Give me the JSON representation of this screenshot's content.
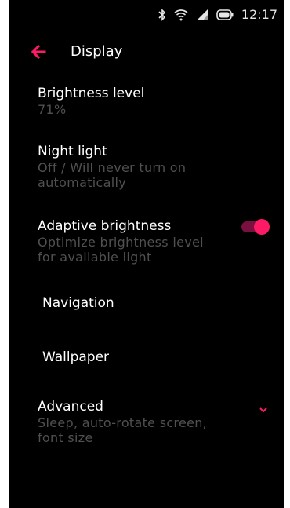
{
  "status_bar": {
    "time": "12:17",
    "icons": [
      "bluetooth-icon",
      "wifi-icon",
      "cell-signal-icon",
      "battery-icon"
    ]
  },
  "app_bar": {
    "back_icon": "arrow-left-icon",
    "title": "Display"
  },
  "settings": {
    "brightness": {
      "title": "Brightness level",
      "value": "71%"
    },
    "night_light": {
      "title": "Night light",
      "summary": "Off / Will never turn on automatically"
    },
    "adaptive_brightness": {
      "title": "Adaptive brightness",
      "summary": "Optimize brightness level for available light",
      "enabled": true
    },
    "navigation": {
      "title": "Navigation"
    },
    "wallpaper": {
      "title": "Wallpaper"
    },
    "advanced": {
      "title": "Advanced",
      "summary": "Sleep, auto-rotate screen, font size",
      "expand_icon": "chevron-down-icon"
    }
  },
  "colors": {
    "accent": "#ff1a66",
    "background": "#000000",
    "text_primary": "#ffffff",
    "text_secondary": "#505050"
  }
}
